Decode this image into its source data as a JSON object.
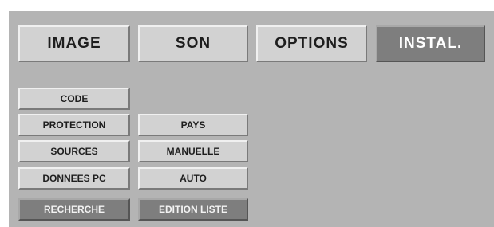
{
  "tabs": [
    {
      "label": "IMAGE",
      "active": false
    },
    {
      "label": "SON",
      "active": false
    },
    {
      "label": "OPTIONS",
      "active": false
    },
    {
      "label": "INSTAL.",
      "active": true
    }
  ],
  "menu_column1": [
    {
      "label": "CODE",
      "selected": false
    },
    {
      "label": "PROTECTION",
      "selected": false
    },
    {
      "label": "SOURCES",
      "selected": false
    },
    {
      "label": "DONNEES PC",
      "selected": false
    },
    {
      "label": "RECHERCHE",
      "selected": true
    }
  ],
  "menu_column2": [
    {
      "label": "PAYS",
      "selected": false
    },
    {
      "label": "MANUELLE",
      "selected": false
    },
    {
      "label": "AUTO",
      "selected": false
    },
    {
      "label": "EDITION LISTE",
      "selected": true
    }
  ],
  "colors": {
    "panel_bg": "#b4b4b4",
    "button_face": "#d2d2d2",
    "selected_face": "#7e7e7e"
  }
}
